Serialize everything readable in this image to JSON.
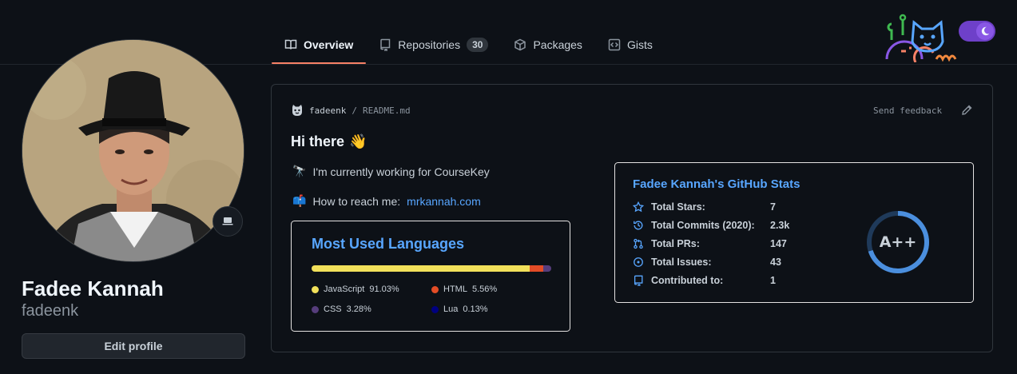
{
  "tabs": [
    {
      "label": "Overview",
      "icon": "book-icon",
      "active": true
    },
    {
      "label": "Repositories",
      "icon": "repo-icon",
      "count": "30"
    },
    {
      "label": "Packages",
      "icon": "package-icon"
    },
    {
      "label": "Gists",
      "icon": "code-square-icon"
    }
  ],
  "profile": {
    "full_name": "Fadee Kannah",
    "username": "fadeenk",
    "edit_label": "Edit profile",
    "status_icon": "laptop-icon"
  },
  "readme": {
    "owner": "fadeenk",
    "separator": "/",
    "file": "README.md",
    "feedback": "Send feedback",
    "greeting": "Hi there",
    "greeting_emoji": "👋",
    "working_emoji": "🔭",
    "working_text": "I'm currently working for CourseKey",
    "reach_emoji": "📫",
    "reach_text": "How to reach me:",
    "reach_link": "mrkannah.com"
  },
  "languages_card": {
    "title": "Most Used Languages",
    "items": [
      {
        "name": "JavaScript",
        "percent": "91.03%",
        "value": 91.03,
        "color": "#f1e05a"
      },
      {
        "name": "HTML",
        "percent": "5.56%",
        "value": 5.56,
        "color": "#e34c26"
      },
      {
        "name": "CSS",
        "percent": "3.28%",
        "value": 3.28,
        "color": "#563d7c"
      },
      {
        "name": "Lua",
        "percent": "0.13%",
        "value": 0.13,
        "color": "#000080"
      }
    ]
  },
  "stats_card": {
    "title": "Fadee Kannah's GitHub Stats",
    "rows": [
      {
        "label": "Total Stars:",
        "value": "7",
        "icon": "star-icon"
      },
      {
        "label": "Total Commits (2020):",
        "value": "2.3k",
        "icon": "history-icon"
      },
      {
        "label": "Total PRs:",
        "value": "147",
        "icon": "pull-request-icon"
      },
      {
        "label": "Total Issues:",
        "value": "43",
        "icon": "issue-icon"
      },
      {
        "label": "Contributed to:",
        "value": "1",
        "icon": "repo-icon"
      }
    ],
    "grade": "A++",
    "grade_progress": 0.7
  },
  "colors": {
    "accent": "#58a6ff",
    "tab_underline": "#f78166",
    "toggle": "#6e40c9"
  }
}
